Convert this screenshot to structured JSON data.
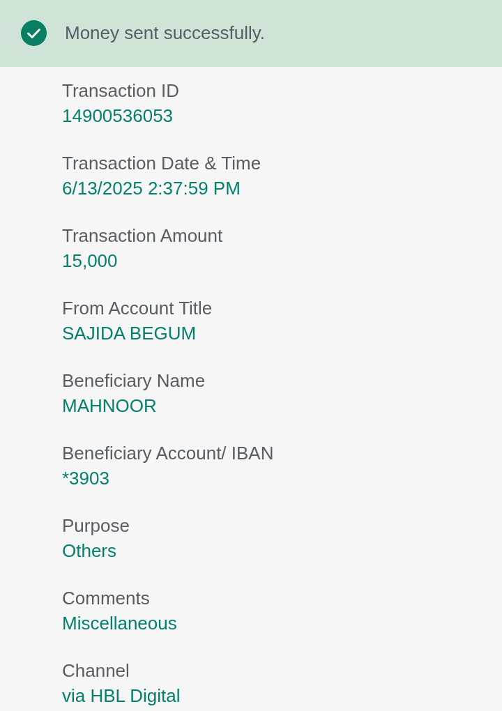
{
  "banner": {
    "message": "Money sent successfully."
  },
  "details": [
    {
      "label": "Transaction ID",
      "value": "14900536053"
    },
    {
      "label": "Transaction Date & Time",
      "value": "6/13/2025 2:37:59 PM"
    },
    {
      "label": "Transaction Amount",
      "value": "15,000"
    },
    {
      "label": "From Account Title",
      "value": "SAJIDA BEGUM"
    },
    {
      "label": "Beneficiary Name",
      "value": "MAHNOOR"
    },
    {
      "label": "Beneficiary Account/ IBAN",
      "value": "*3903"
    },
    {
      "label": "Purpose",
      "value": "Others"
    },
    {
      "label": "Comments",
      "value": "Miscellaneous"
    },
    {
      "label": "Channel",
      "value": "via HBL Digital"
    }
  ]
}
